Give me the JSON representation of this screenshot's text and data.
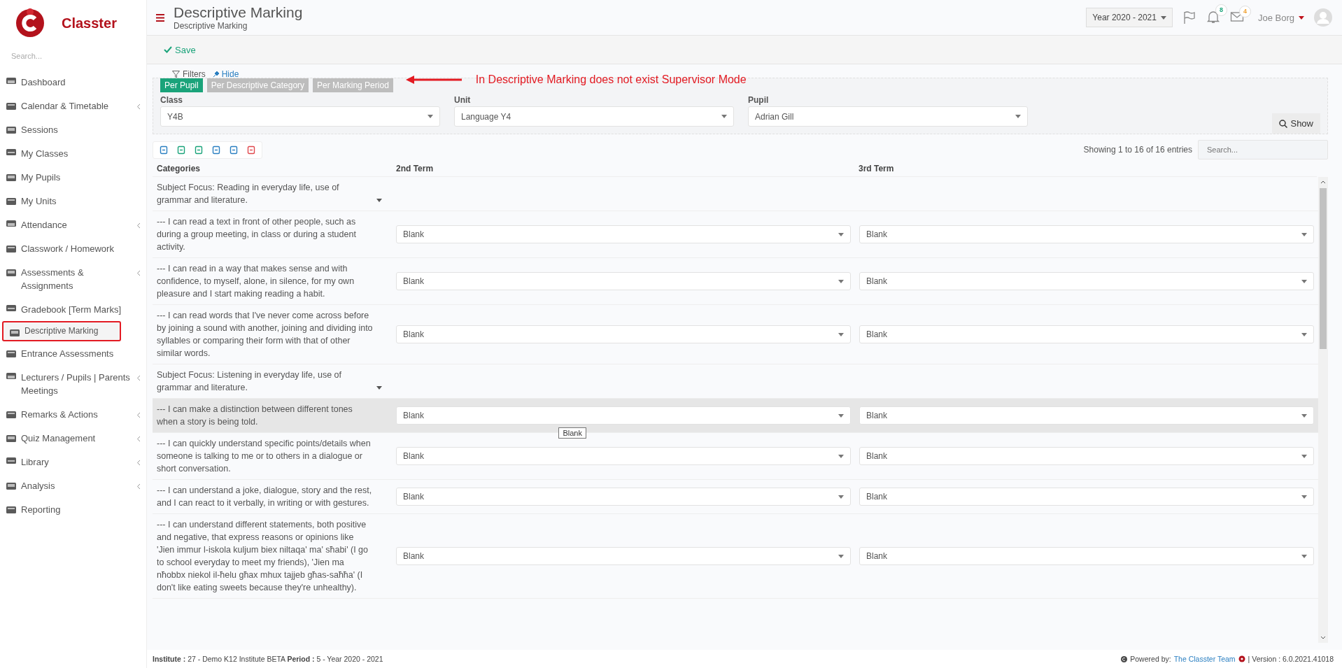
{
  "app": {
    "name": "Classter"
  },
  "sidebar": {
    "search_placeholder": "Search...",
    "items": [
      {
        "label": "Dashboard",
        "selected": false,
        "expandable": false,
        "outlined": false
      },
      {
        "label": "Calendar & Timetable",
        "selected": false,
        "expandable": true,
        "outlined": false
      },
      {
        "label": "Sessions",
        "selected": false,
        "expandable": false,
        "outlined": false
      },
      {
        "label": "My Classes",
        "selected": false,
        "expandable": false,
        "outlined": false
      },
      {
        "label": "My Pupils",
        "selected": false,
        "expandable": false,
        "outlined": false
      },
      {
        "label": "My Units",
        "selected": false,
        "expandable": false,
        "outlined": false
      },
      {
        "label": "Attendance",
        "selected": false,
        "expandable": true,
        "outlined": false
      },
      {
        "label": "Classwork / Homework",
        "selected": false,
        "expandable": false,
        "outlined": false
      },
      {
        "label": "Assessments & Assignments",
        "selected": false,
        "expandable": true,
        "outlined": false
      },
      {
        "label": "Gradebook [Term Marks]",
        "selected": false,
        "expandable": false,
        "outlined": false
      },
      {
        "label": "Descriptive Marking",
        "selected": true,
        "expandable": false,
        "outlined": true
      },
      {
        "label": "Entrance Assessments",
        "selected": false,
        "expandable": false,
        "outlined": false
      },
      {
        "label": "Lecturers / Pupils | Parents Meetings",
        "selected": false,
        "expandable": true,
        "outlined": false
      },
      {
        "label": "Remarks & Actions",
        "selected": false,
        "expandable": true,
        "outlined": false
      },
      {
        "label": "Quiz Management",
        "selected": false,
        "expandable": true,
        "outlined": false
      },
      {
        "label": "Library",
        "selected": false,
        "expandable": true,
        "outlined": false
      },
      {
        "label": "Analysis",
        "selected": false,
        "expandable": true,
        "outlined": false
      },
      {
        "label": "Reporting",
        "selected": false,
        "expandable": false,
        "outlined": false
      }
    ]
  },
  "header": {
    "title": "Descriptive Marking",
    "subtitle": "Descriptive Marking",
    "year": "Year 2020 - 2021",
    "notifications": "8",
    "messages": "4",
    "user": "Joe Borg"
  },
  "actions": {
    "save": "Save"
  },
  "filters": {
    "label": "Filters",
    "hide": "Hide",
    "modes": [
      {
        "label": "Per Pupil",
        "selected": true
      },
      {
        "label": "Per Descriptive Category",
        "selected": false
      },
      {
        "label": "Per Marking Period",
        "selected": false
      }
    ],
    "fields": [
      {
        "label": "Class",
        "value": "Y4B"
      },
      {
        "label": "Unit",
        "value": "Language Y4"
      },
      {
        "label": "Pupil",
        "value": "Adrian Gill"
      }
    ],
    "show": "Show"
  },
  "annotation": {
    "text": "In Descriptive Marking does not exist Supervisor Mode"
  },
  "table": {
    "info": "Showing 1 to 16 of 16 entries",
    "search_placeholder": "Search...",
    "columns": [
      "Categories",
      "2nd Term",
      "3rd Term"
    ],
    "rows": [
      {
        "kind": "focus",
        "text": "Subject Focus: Reading in everyday life, use of grammar and literature.",
        "hovered": false
      },
      {
        "kind": "item",
        "text": "--- I can read a text in front of other people, such as during a group meeting, in class or during a student activity.",
        "terms": [
          "Blank",
          "Blank"
        ],
        "hovered": false
      },
      {
        "kind": "item",
        "text": "--- I can read in a way that makes sense and with confidence, to myself, alone, in silence, for my own pleasure and I start making reading a habit.",
        "terms": [
          "Blank",
          "Blank"
        ],
        "hovered": false
      },
      {
        "kind": "item",
        "text": "--- I can read words that I've never come across before by joining a sound with another, joining and dividing into syllables or comparing their form with that of other similar words.",
        "terms": [
          "Blank",
          "Blank"
        ],
        "hovered": false
      },
      {
        "kind": "focus",
        "text": "Subject Focus: Listening in everyday life, use of grammar and literature.",
        "hovered": false
      },
      {
        "kind": "item",
        "text": "--- I can make a distinction between different tones when a story is being told.",
        "terms": [
          "Blank",
          "Blank"
        ],
        "hovered": true,
        "tooltip": "Blank"
      },
      {
        "kind": "item",
        "text": "--- I can quickly understand specific points/details when someone is talking to me or to others in a dialogue or short conversation.",
        "terms": [
          "Blank",
          "Blank"
        ],
        "hovered": false
      },
      {
        "kind": "item",
        "text": "--- I can understand a joke, dialogue, story and the rest, and I can react to it verbally, in writing or with gestures.",
        "terms": [
          "Blank",
          "Blank"
        ],
        "hovered": false
      },
      {
        "kind": "item",
        "text": "--- I can understand different statements, both positive and negative, that express reasons or opinions like 'Jien immur l-iskola kuljum biex niltaqa' ma' sħabi' (I go to school everyday to meet my friends), 'Jien ma nħobbx niekol il-ħelu għax mhux tajjeb għas-saħħa' (I don't like eating sweets because they're unhealthy).",
        "terms": [
          "Blank",
          "Blank"
        ],
        "hovered": false
      }
    ]
  },
  "footer": {
    "info": "**Institute :** 27 - Demo K12 Institute BETA **Period :** 5 - Year 2020 - 2021",
    "powered": "Powered by:",
    "team": "The Classter Team",
    "version": "| Version : 6.0.2021.41018"
  }
}
